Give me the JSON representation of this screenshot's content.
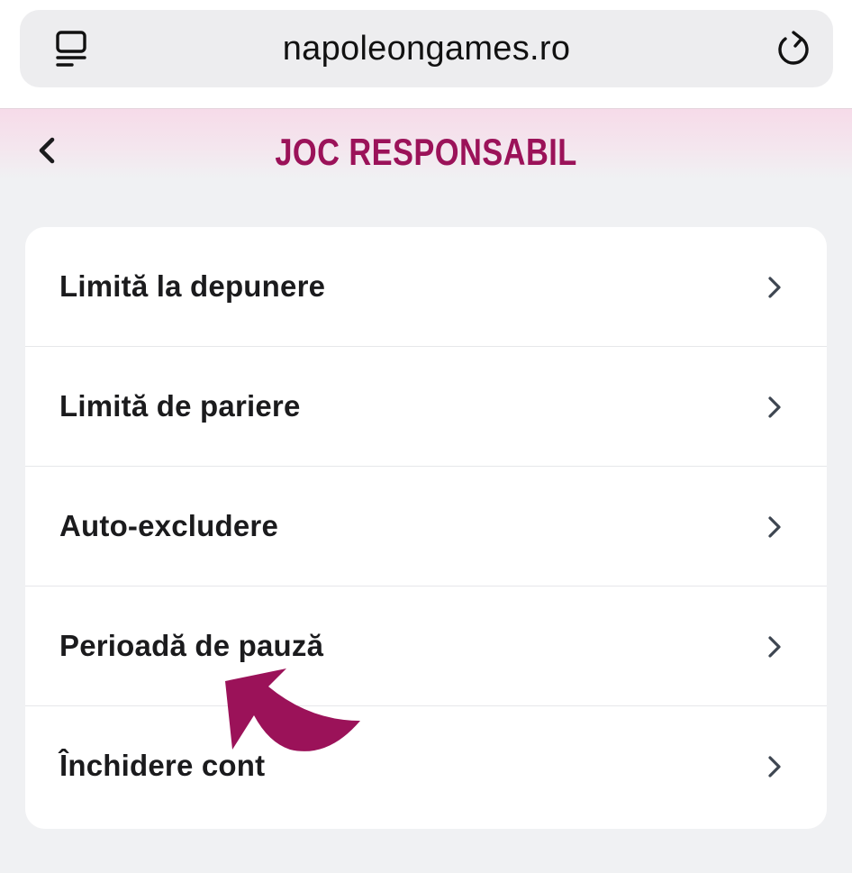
{
  "browser": {
    "url": "napoleongames.ro",
    "tabs_icon": "tabs-list-icon",
    "reload_icon": "reload-icon"
  },
  "header": {
    "title": "JOC RESPONSABIL",
    "back_icon": "chevron-left-icon"
  },
  "menu": {
    "items": [
      {
        "label": "Limită la depunere"
      },
      {
        "label": "Limită de pariere"
      },
      {
        "label": "Auto-excludere"
      },
      {
        "label": "Perioadă de pauză"
      },
      {
        "label": "Închidere cont"
      }
    ],
    "chevron_icon": "chevron-right-icon"
  },
  "colors": {
    "accent": "#9b1259",
    "header_tint": "#f6dbe9",
    "background": "#f0f1f3",
    "card": "#ffffff",
    "text": "#1b1b1d"
  },
  "annotation": {
    "icon": "curved-arrow-annotation",
    "points_to": "Perioadă de pauză"
  }
}
